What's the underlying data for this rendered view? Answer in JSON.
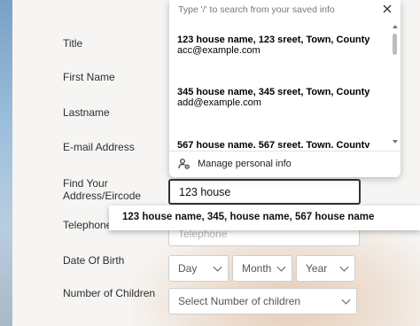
{
  "form": {
    "labels": {
      "title": "Title",
      "first_name": "First Name",
      "lastname": "Lastname",
      "email": "E-mail Address",
      "find_address_line1": "Find Your",
      "find_address_line2": "Address/Eircode",
      "telephone": "Telephone",
      "dob": "Date Of Birth",
      "children": "Number of Children"
    },
    "address_input_value": "123 house",
    "telephone_placeholder": "Telephone",
    "dob": {
      "day": "Day",
      "month": "Month",
      "year": "Year"
    },
    "children_select": "Select Number of children"
  },
  "saved_info_popup": {
    "hint": "Type '/' to search from your saved info",
    "suggestions": [
      {
        "address": "123 house name, 123 sreet, Town, County",
        "email": "acc@example.com"
      },
      {
        "address": "345 house name, 345 sreet, Town, County",
        "email": "add@example.com"
      },
      {
        "address": "567 house name, 567 sreet, Town, County",
        "email": ""
      }
    ],
    "manage_label": "Manage personal info"
  },
  "autofill_suggestion": "123 house name, 345, house name, 567 house name",
  "icons": {
    "close": "close-icon",
    "manage": "person-settings-icon"
  }
}
